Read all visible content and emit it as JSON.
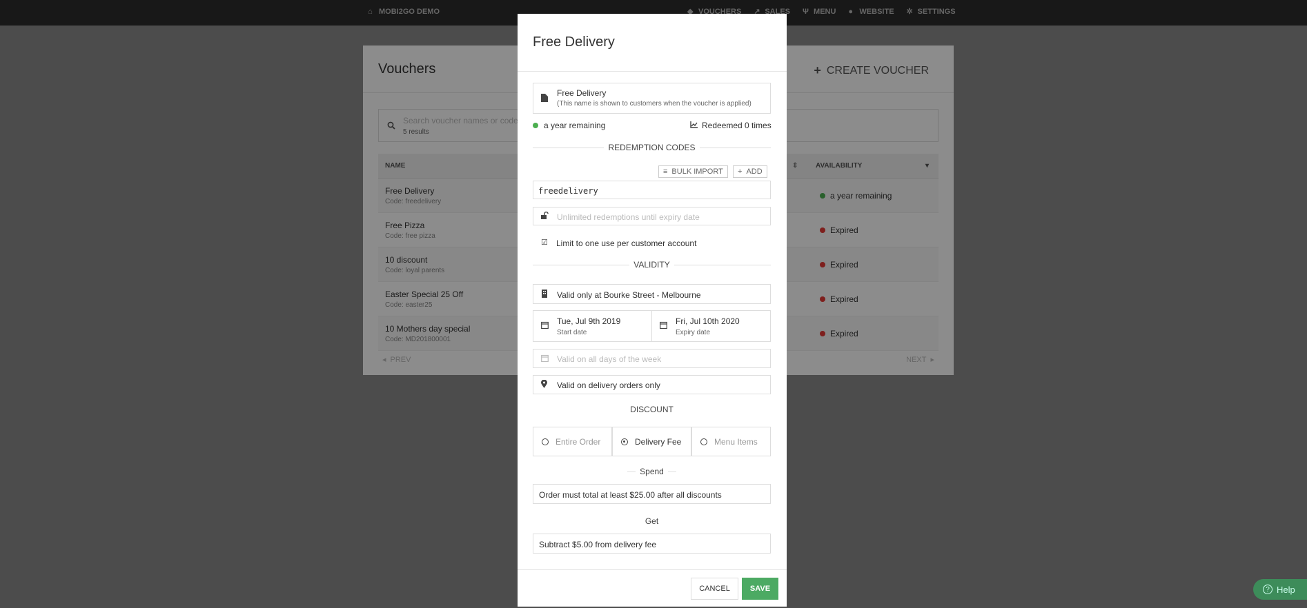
{
  "topbar": {
    "brand": "MOBI2GO DEMO",
    "nav": [
      "VOUCHERS",
      "SALES",
      "MENU",
      "WEBSITE",
      "SETTINGS"
    ]
  },
  "vouchers": {
    "title": "Vouchers",
    "create_label": "CREATE VOUCHER",
    "search_placeholder": "Search voucher names or codes",
    "results": "5 results",
    "col_name": "NAME",
    "col_availability": "AVAILABILITY",
    "rows": [
      {
        "name": "Free Delivery",
        "code": "Code: freedelivery",
        "status": "a year remaining",
        "status_color": "#4caf50"
      },
      {
        "name": "Free Pizza",
        "code": "Code: free pizza",
        "status": "Expired",
        "status_color": "#e53935"
      },
      {
        "name": "10 discount",
        "code": "Code: loyal parents",
        "status": "Expired",
        "status_color": "#e53935"
      },
      {
        "name": "Easter Special 25 Off",
        "code": "Code: easter25",
        "status": "Expired",
        "status_color": "#e53935"
      },
      {
        "name": "10 Mothers day special",
        "code": "Code: MD201800001",
        "status": "Expired",
        "status_color": "#e53935"
      }
    ],
    "prev": "PREV",
    "next": "NEXT"
  },
  "help": "Help",
  "modal": {
    "title": "Free Delivery",
    "name_value": "Free Delivery",
    "name_hint": "(This name is shown to customers when the voucher is applied)",
    "remaining": "a year remaining",
    "redeemed": "Redeemed 0 times",
    "redemption_heading": "REDEMPTION CODES",
    "bulk_import": "BULK IMPORT",
    "add": "ADD",
    "code_value": "freedelivery",
    "unlimited_placeholder": "Unlimited redemptions until expiry date",
    "limit_one": "Limit to one use per customer account",
    "validity_heading": "VALIDITY",
    "location": "Valid only at Bourke Street - Melbourne",
    "start_date": "Tue, Jul 9th 2019",
    "start_label": "Start date",
    "expiry_date": "Fri, Jul 10th 2020",
    "expiry_label": "Expiry date",
    "days_placeholder": "Valid on all days of the week",
    "delivery_only": "Valid on delivery orders only",
    "discount_heading": "DISCOUNT",
    "discount_options": [
      "Entire Order",
      "Delivery Fee",
      "Menu Items"
    ],
    "selected_discount": "Delivery Fee",
    "spend_heading": "Spend",
    "spend_value": "Order must total at least $25.00 after all discounts",
    "get_heading": "Get",
    "get_value": "Subtract $5.00 from delivery fee",
    "cancel": "CANCEL",
    "save": "SAVE"
  }
}
